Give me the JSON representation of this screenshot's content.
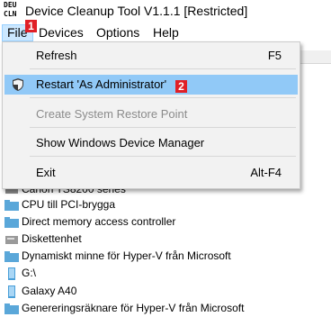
{
  "window": {
    "title": "Device Cleanup Tool V1.1.1  [Restricted]",
    "icon_lines": [
      "DEU",
      "CLN"
    ]
  },
  "menubar": {
    "items": [
      "File",
      "Devices",
      "Options",
      "Help"
    ],
    "active": "File"
  },
  "badges": {
    "first": "1",
    "second": "2"
  },
  "file_menu": {
    "items": [
      {
        "label": "Refresh",
        "shortcut": "F5",
        "disabled": false
      },
      {
        "label": "Restart 'As Administrator'",
        "shortcut": "",
        "disabled": false,
        "icon": "shield-icon",
        "highlighted": true
      },
      {
        "label": "Create System Restore Point",
        "shortcut": "",
        "disabled": true
      },
      {
        "label": "Show Windows Device Manager",
        "shortcut": "",
        "disabled": false
      },
      {
        "label": "Exit",
        "shortcut": "Alt-F4",
        "disabled": false
      }
    ]
  },
  "device_list": {
    "items": [
      {
        "label": "Canon TS8200 series",
        "icon": "printer-icon"
      },
      {
        "label": "CPU till PCI-brygga",
        "icon": "folder-icon"
      },
      {
        "label": "Direct memory access controller",
        "icon": "folder-icon"
      },
      {
        "label": "Diskettenhet",
        "icon": "drive-icon"
      },
      {
        "label": "Dynamiskt minne för Hyper-V från Microsoft",
        "icon": "folder-icon"
      },
      {
        "label": "G:\\",
        "icon": "device-icon"
      },
      {
        "label": "Galaxy A40",
        "icon": "device-icon"
      },
      {
        "label": "Genereringsräknare för Hyper-V från Microsoft",
        "icon": "folder-icon"
      }
    ]
  },
  "colors": {
    "highlight": "#91c9f7",
    "menu_active": "#cce8ff",
    "badge": "#e01f26",
    "menu_bg": "#f2f2f2"
  }
}
